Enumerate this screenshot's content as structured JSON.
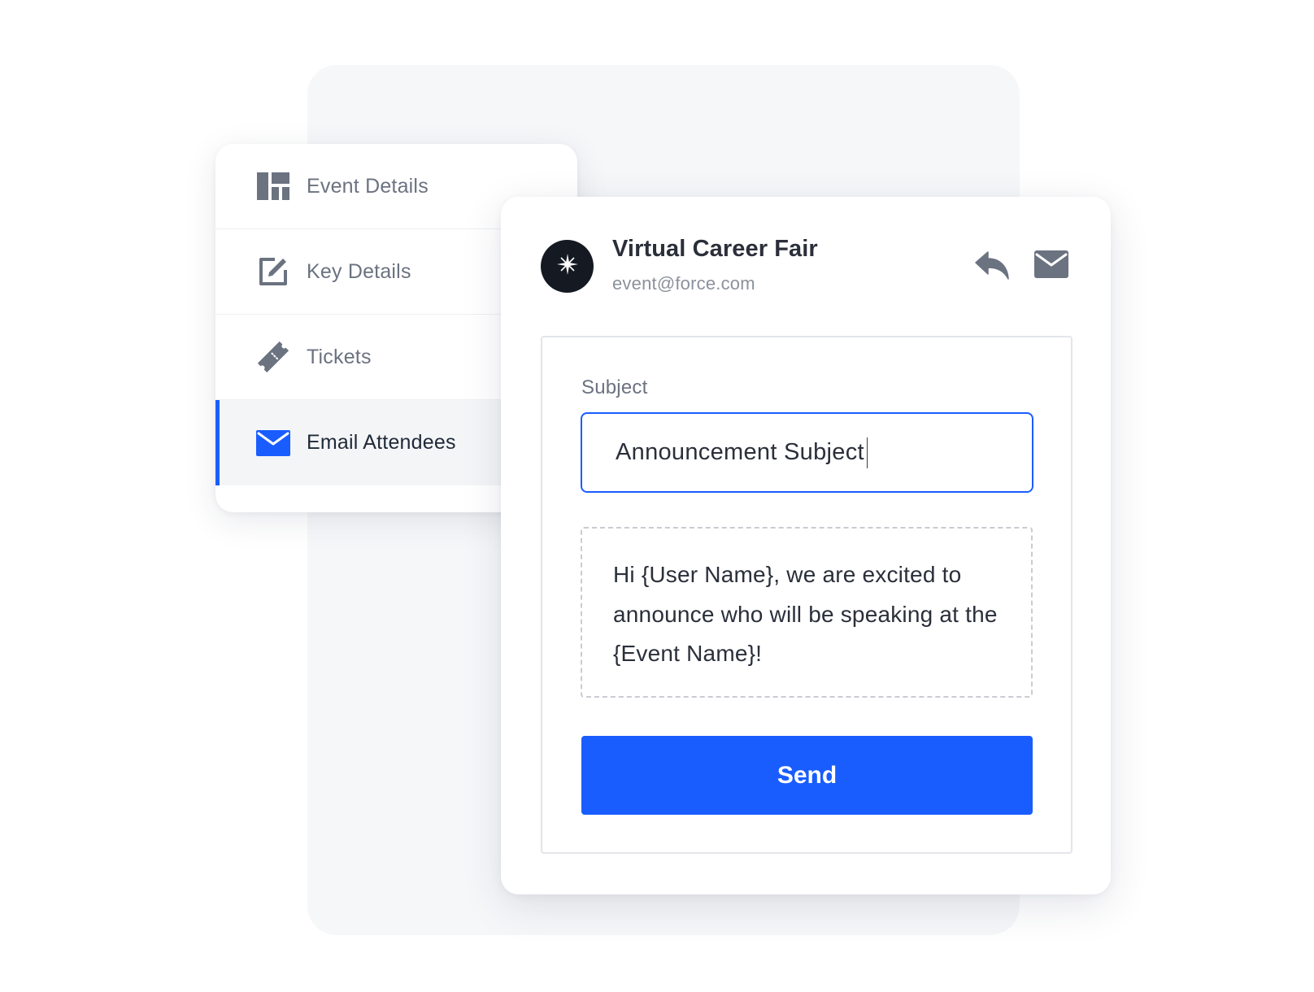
{
  "sidebar": {
    "items": [
      {
        "label": "Event Details",
        "icon": "dashboard-icon",
        "active": false
      },
      {
        "label": "Key Details",
        "icon": "edit-icon",
        "active": false
      },
      {
        "label": "Tickets",
        "icon": "ticket-icon",
        "active": false
      },
      {
        "label": "Email Attendees",
        "icon": "envelope-icon",
        "active": true
      }
    ]
  },
  "email": {
    "sender_name": "Virtual Career Fair",
    "sender_email": "event@force.com",
    "avatar_icon": "star-icon",
    "actions": [
      "reply-icon",
      "envelope-icon"
    ],
    "subject_label": "Subject",
    "subject_value": "Announcement Subject",
    "message": "Hi {User Name}, we are excited to announce who will be speaking at the {Event Name}!",
    "send_label": "Send"
  },
  "colors": {
    "accent": "#1a5dff",
    "background_card": "#f6f7f9",
    "icon_gray": "#6b7280",
    "avatar_bg": "#141922"
  }
}
